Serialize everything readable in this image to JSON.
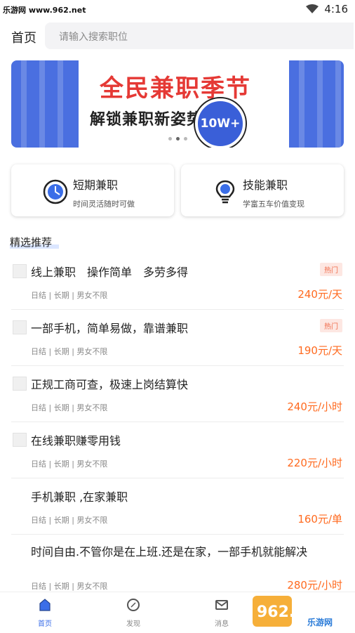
{
  "status": {
    "watermark_text": "乐游网 www.962.net",
    "time": "4:16"
  },
  "header": {
    "title": "首页",
    "search_placeholder": "请输入搜索职位"
  },
  "banner": {
    "title": "全民兼职季节",
    "subtitle": "解锁兼职新姿势",
    "badge": "10W+",
    "dots": 3,
    "active_dot": 1
  },
  "categories": [
    {
      "title": "短期兼职",
      "subtitle": "时间灵活随时可做",
      "icon": "clock-icon"
    },
    {
      "title": "技能兼职",
      "subtitle": "学富五车价值变现",
      "icon": "lightbulb-icon"
    }
  ],
  "section": {
    "title": "精选推荐"
  },
  "jobs": [
    {
      "title": "线上兼职　操作简单　多劳多得",
      "meta": "日结 | 长期 | 男女不限",
      "price": "240元/天",
      "hot": "热门"
    },
    {
      "title": "一部手机，简单易做，靠谱兼职",
      "meta": "日结 | 长期 | 男女不限",
      "price": "190元/天",
      "hot": "热门"
    },
    {
      "title": "正规工商可查，极速上岗结算快",
      "meta": "日结 | 长期 | 男女不限",
      "price": "240元/小时",
      "hot": ""
    },
    {
      "title": "在线兼职赚零用钱",
      "meta": "日结 | 长期 | 男女不限",
      "price": "220元/小时",
      "hot": ""
    },
    {
      "title": "手机兼职 ,在家兼职",
      "meta": "日结 | 长期 | 男女不限",
      "price": "160元/单",
      "hot": ""
    },
    {
      "title": "时间自由.不管你是在上班.还是在家，一部手机就能解决",
      "meta": "日结 | 长期 | 男女不限",
      "price": "280元/小时",
      "hot": ""
    }
  ],
  "tabs": [
    {
      "label": "首页",
      "icon": "home-icon",
      "active": true
    },
    {
      "label": "发现",
      "icon": "compass-icon",
      "active": false
    },
    {
      "label": "消息",
      "icon": "mail-icon",
      "active": false
    }
  ],
  "watermark": {
    "text": "962.NET",
    "subtext": "乐游网"
  },
  "colors": {
    "accent": "#3b6ee8",
    "price": "#ff6a1f",
    "banner_blue": "#4a6fe0",
    "banner_red": "#e53935"
  }
}
